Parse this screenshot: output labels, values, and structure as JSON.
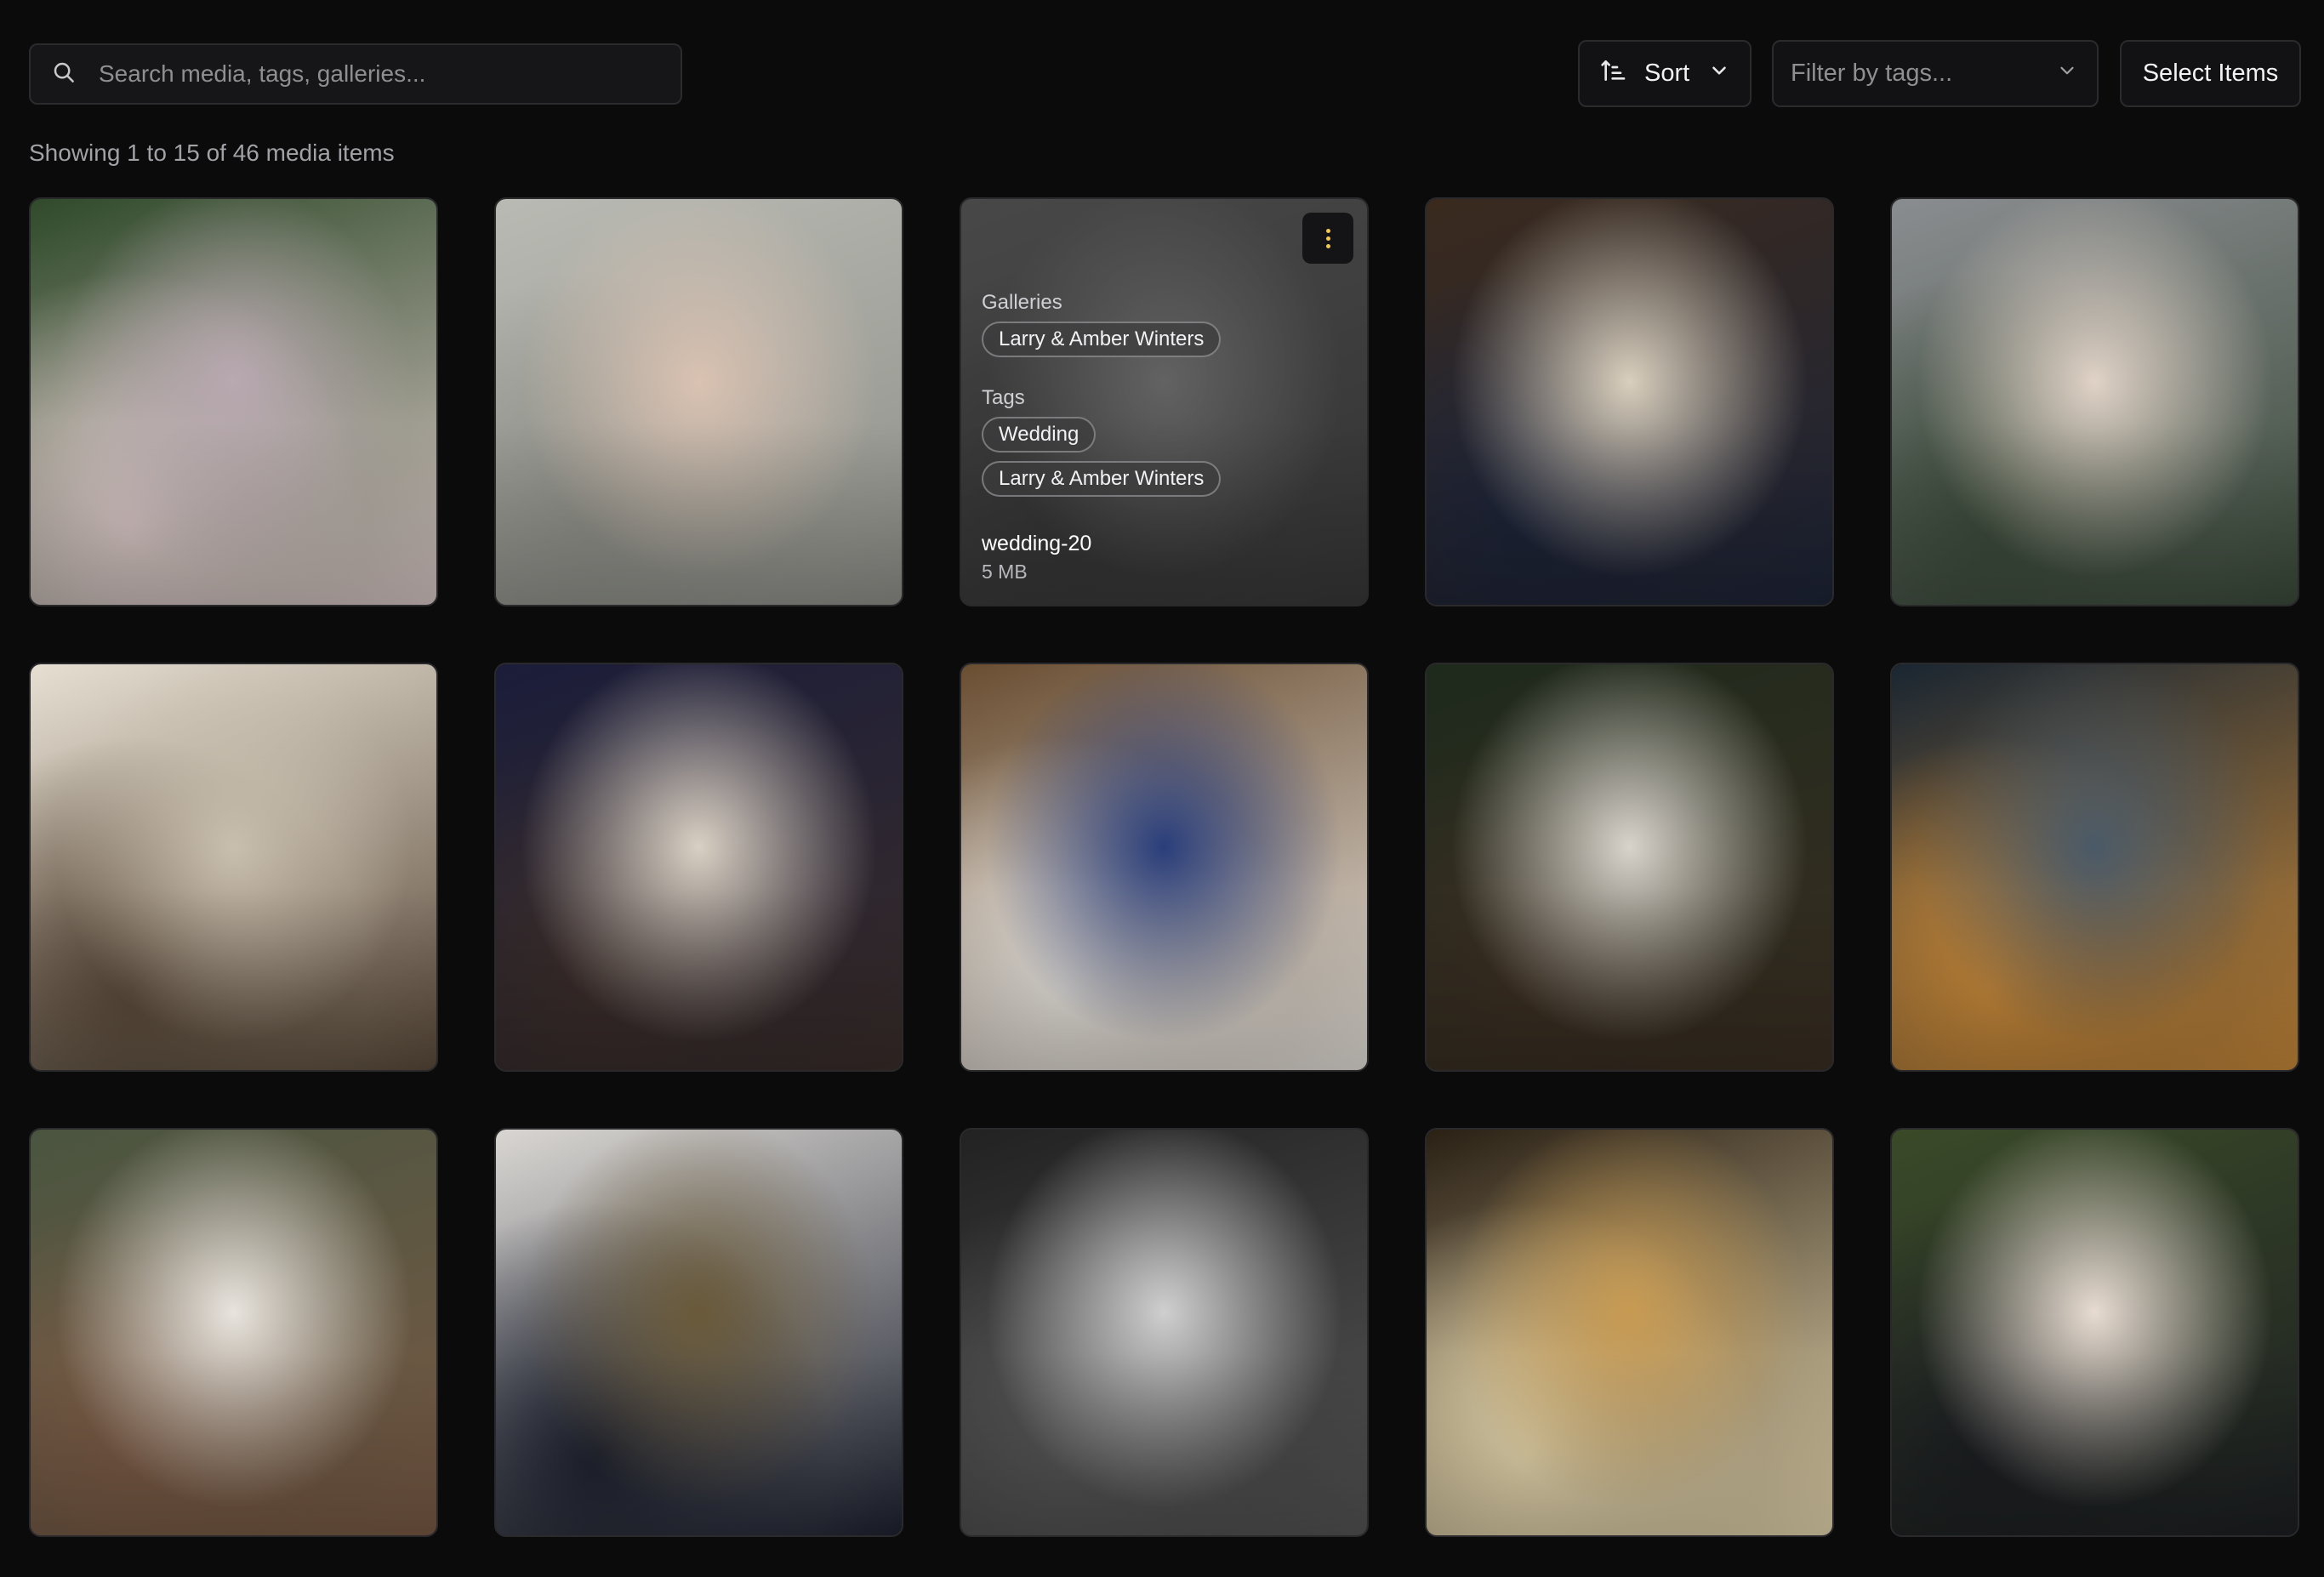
{
  "toolbar": {
    "search_placeholder": "Search media, tags, galleries...",
    "sort_label": "Sort",
    "filter_placeholder": "Filter by tags...",
    "select_label": "Select Items"
  },
  "summary": "Showing 1 to 15 of 46 media items",
  "colors": {
    "background": "#0b0b0c",
    "surface": "#161618",
    "border": "#2b2b2e",
    "kebab_dots": "#f2c94c"
  },
  "overlay": {
    "galleries_heading": "Galleries",
    "galleries": [
      "Larry & Amber Winters"
    ],
    "tags_heading": "Tags",
    "tags": [
      "Wedding",
      "Larry & Amber Winters"
    ],
    "file_name": "wedding-20",
    "file_size": "5 MB"
  },
  "media": [
    {
      "id": "bridesmaids-balloons",
      "colors": [
        "#2f4a2a",
        "#b8a8b0",
        "#d9c8c6"
      ]
    },
    {
      "id": "ring-hands",
      "colors": [
        "#b9bab3",
        "#d9c2b2",
        "#8e8f88"
      ]
    },
    {
      "id": "heart-sand",
      "colors": [
        "#6a6a6a",
        "#9a9a9a",
        "#444444"
      ],
      "selected": true
    },
    {
      "id": "bouquet-couple",
      "colors": [
        "#3a2a1e",
        "#d9cfbd",
        "#1d2438"
      ]
    },
    {
      "id": "bride-car",
      "colors": [
        "#8a8d90",
        "#e0d2c6",
        "#3b4a3a"
      ]
    },
    {
      "id": "dress-closeup",
      "colors": [
        "#e6dfd2",
        "#c9bfae",
        "#5a4a3a"
      ]
    },
    {
      "id": "sparkler-kiss",
      "colors": [
        "#1b1d3a",
        "#d9d0c4",
        "#3a2d2a"
      ]
    },
    {
      "id": "aisle-exit",
      "colors": [
        "#6a4e32",
        "#2a3e7a",
        "#e6e2dc"
      ]
    },
    {
      "id": "bench-couple",
      "colors": [
        "#1e2a1c",
        "#d8d4cc",
        "#3a2e22"
      ]
    },
    {
      "id": "sparklers-night",
      "colors": [
        "#1a2632",
        "#4a5a68",
        "#c98a3a"
      ]
    },
    {
      "id": "piggyback-couple",
      "colors": [
        "#4a5540",
        "#e8e4de",
        "#7a5a45"
      ]
    },
    {
      "id": "hilltop-couple",
      "colors": [
        "#d9d6d2",
        "#6a5a3a",
        "#1e2230"
      ]
    },
    {
      "id": "confetti-bw",
      "colors": [
        "#222222",
        "#cfcfcf",
        "#555555"
      ]
    },
    {
      "id": "reception-toast",
      "colors": [
        "#2a2014",
        "#c79a52",
        "#e8d9b0"
      ]
    },
    {
      "id": "holding-hands",
      "colors": [
        "#3a4a28",
        "#e8dcd2",
        "#1c1e22"
      ]
    }
  ]
}
